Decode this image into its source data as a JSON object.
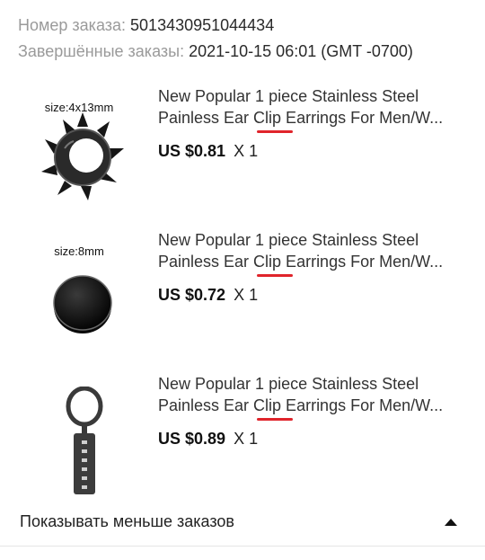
{
  "order": {
    "number_label": "Номер заказа:",
    "number_value": "5013430951044434",
    "completed_label": "Завершённые заказы:",
    "completed_value": "2021-10-15 06:01 (GMT -0700)"
  },
  "items": [
    {
      "size": "size:4x13mm",
      "title_line1": "New Popular 1 piece Stainless Steel",
      "title_line2": "Painless Ear Clip Earrings For Men/W...",
      "price": "US $0.81",
      "qty": "X 1",
      "image_icon": "spiked-hoop-earring-icon"
    },
    {
      "size": "size:8mm",
      "title_line1": "New Popular 1 piece Stainless Steel",
      "title_line2": "Painless Ear Clip Earrings For Men/W...",
      "price": "US $0.72",
      "qty": "X 1",
      "image_icon": "round-stud-earring-icon"
    },
    {
      "size": "",
      "title_line1": "New Popular 1 piece Stainless Steel",
      "title_line2": "Painless Ear Clip Earrings For Men/W...",
      "price": "US $0.89",
      "qty": "X 1",
      "image_icon": "blade-pendant-earring-icon"
    }
  ],
  "footer": {
    "toggle_label": "Показывать меньше заказов",
    "toggle_icon": "triangle-up-icon"
  },
  "colors": {
    "highlight_underline": "#e0242b",
    "muted_label": "#9a9a9a"
  }
}
